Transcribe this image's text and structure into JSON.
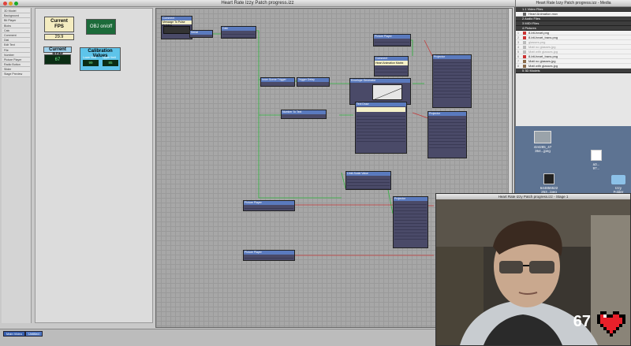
{
  "main_window": {
    "title": "Heart Rate Izzy Patch progress.izz",
    "left_panel": [
      "3D Model",
      "Background",
      "Bit Player",
      "Blobs",
      "Calc",
      "Comment",
      "Dial",
      "Edit Text",
      "File",
      "Number",
      "Picture Player",
      "Radio Button",
      "Slider",
      "Stage Preview"
    ],
    "controls": {
      "fps_label": "Current\nFPS",
      "fps_value": "29.9",
      "obj_button": "OBJ on/off",
      "bpm_label": "Current BPM",
      "bpm_value": "67",
      "calib_label": "Calibration Values",
      "calib_lower_label": "Lower limit",
      "calib_upper_label": "Upper limit",
      "calib_lower": "99",
      "calib_upper": "85"
    },
    "status_buttons": [
      "Main Video",
      "Untitled"
    ]
  },
  "nodes": [
    {
      "title": "Comment",
      "extra": "Message To Pulse Arduino"
    },
    {
      "title": "Serial"
    },
    {
      "title": "Calc"
    },
    {
      "title": "Picture Player",
      "ports": [
        "video out",
        "trigger"
      ]
    },
    {
      "title": "Comment",
      "extra": "Heart Animation Matrix"
    },
    {
      "title": "Projector",
      "ports": [
        "video in",
        "horz pos",
        "vert pos",
        "width",
        "height",
        "aspect mode",
        "keep aspect",
        "zoom",
        "rotate",
        "intensity",
        "blend",
        "layer"
      ]
    },
    {
      "title": "Inner Scene Trigger"
    },
    {
      "title": "Trigger Delay"
    },
    {
      "title": "Envelope Generator",
      "ports": [
        "trigger",
        "rise/fall",
        "range",
        "output"
      ]
    },
    {
      "title": "Number To Text"
    },
    {
      "title": "Text Draw",
      "ports": [
        "right text",
        "font",
        "size",
        "h align",
        "v align",
        "leading",
        "width",
        "height",
        "spacing"
      ]
    },
    {
      "title": "Projector",
      "ports": [
        "video in",
        "horz pos",
        "vert pos",
        "width",
        "height",
        "zoom"
      ]
    },
    {
      "title": "Limit-Scale Value",
      "ports": [
        "limit min",
        "limit max",
        "out min",
        "out max"
      ]
    },
    {
      "title": "Picture Player",
      "ports": [
        "picture",
        "video out",
        "trigger"
      ]
    },
    {
      "title": "Projector",
      "ports": [
        "video in",
        "horz pos",
        "vert pos",
        "width",
        "height",
        "aspect mode",
        "keep aspect",
        "zoom",
        "rotate",
        "intensity"
      ]
    },
    {
      "title": "Picture Player",
      "ports": [
        "picture",
        "video out",
        "trigger"
      ]
    }
  ],
  "media_window": {
    "title": "Heart Rate Izzy Patch progress.izz - Media",
    "sections": [
      {
        "name": "1.1 Video Files",
        "items": [
          "Heart Animation.mov"
        ]
      },
      {
        "name": "2 Audio Files",
        "items": []
      },
      {
        "name": "3 MIDI Files",
        "items": []
      },
      {
        "name": "4 Pictures",
        "items": [
          "8-bit-heart.png",
          "8-bit-heart_trans.png",
          "glasses.png",
          "Matt no glasses.jpg",
          "Matt with glasses.jpg",
          "8-bit-heart_trans.png",
          "Matt no glasses.jpg",
          "Matt with glasses.jpg"
        ]
      },
      {
        "name": "5 3D Models",
        "items": []
      }
    ]
  },
  "desktop_files": [
    "424285_47\n364...jpeg",
    "a3...\n97...",
    "644856522\n253...jpeg",
    "Izzy\nFolder"
  ],
  "stage": {
    "title": "Heart Rate Izzy Patch progress.izz - Stage 1",
    "bpm": "67"
  }
}
